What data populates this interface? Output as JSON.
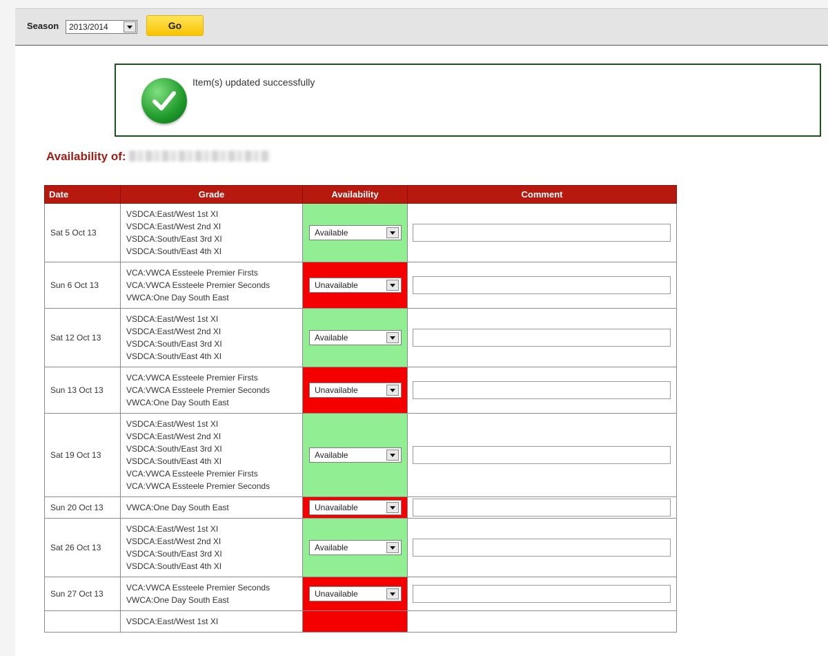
{
  "season": {
    "label": "Season",
    "value": "2013/2014",
    "go_label": "Go"
  },
  "notice": {
    "message": "Item(s) updated successfully"
  },
  "availability": {
    "heading": "Availability of:"
  },
  "table": {
    "headers": {
      "date": "Date",
      "grade": "Grade",
      "availability": "Availability",
      "comment": "Comment"
    },
    "rows": [
      {
        "date": "Sat 5 Oct 13",
        "grades": [
          "VSDCA:East/West 1st XI",
          "VSDCA:East/West 2nd XI",
          "VSDCA:South/East 3rd XI",
          "VSDCA:South/East 4th XI"
        ],
        "availability": "Available",
        "comment": ""
      },
      {
        "date": "Sun 6 Oct 13",
        "grades": [
          "VCA:VWCA Essteele Premier Firsts",
          "VCA:VWCA Essteele Premier Seconds",
          "VWCA:One Day South East"
        ],
        "availability": "Unavailable",
        "comment": ""
      },
      {
        "date": "Sat 12 Oct 13",
        "grades": [
          "VSDCA:East/West 1st XI",
          "VSDCA:East/West 2nd XI",
          "VSDCA:South/East 3rd XI",
          "VSDCA:South/East 4th XI"
        ],
        "availability": "Available",
        "comment": ""
      },
      {
        "date": "Sun 13 Oct 13",
        "grades": [
          "VCA:VWCA Essteele Premier Firsts",
          "VCA:VWCA Essteele Premier Seconds",
          "VWCA:One Day South East"
        ],
        "availability": "Unavailable",
        "comment": ""
      },
      {
        "date": "Sat 19 Oct 13",
        "grades": [
          "VSDCA:East/West 1st XI",
          "VSDCA:East/West 2nd XI",
          "VSDCA:South/East 3rd XI",
          "VSDCA:South/East 4th XI",
          "VCA:VWCA Essteele Premier Firsts",
          "VCA:VWCA Essteele Premier Seconds"
        ],
        "availability": "Available",
        "comment": ""
      },
      {
        "date": "Sun 20 Oct 13",
        "grades": [
          "VWCA:One Day South East"
        ],
        "availability": "Unavailable",
        "comment": ""
      },
      {
        "date": "Sat 26 Oct 13",
        "grades": [
          "VSDCA:East/West 1st XI",
          "VSDCA:East/West 2nd XI",
          "VSDCA:South/East 3rd XI",
          "VSDCA:South/East 4th XI"
        ],
        "availability": "Available",
        "comment": ""
      },
      {
        "date": "Sun 27 Oct 13",
        "grades": [
          "VCA:VWCA Essteele Premier Seconds",
          "VWCA:One Day South East"
        ],
        "availability": "Unavailable",
        "comment": ""
      },
      {
        "date": "",
        "grades": [
          "VSDCA:East/West 1st XI"
        ],
        "availability": "",
        "comment": ""
      }
    ]
  },
  "colors": {
    "available": "#92ee92",
    "unavailable": "#f40000",
    "header": "#b8190f",
    "heading_text": "#a31d17",
    "go_button": "#f8c400"
  }
}
